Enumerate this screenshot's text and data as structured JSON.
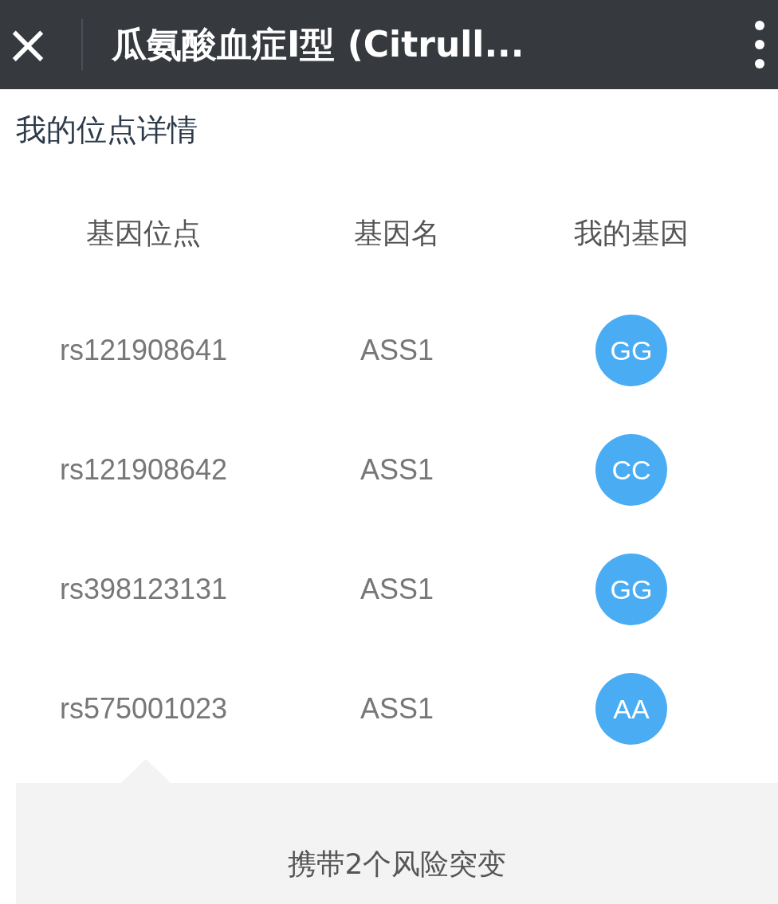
{
  "header": {
    "close_glyph": "×",
    "title": "瓜氨酸血症I型 (Citrull..."
  },
  "section_title": "我的位点详情",
  "table": {
    "columns": [
      "基因位点",
      "基因名",
      "我的基因"
    ],
    "rows": [
      {
        "locus": "rs121908641",
        "gene": "ASS1",
        "genotype": "GG"
      },
      {
        "locus": "rs121908642",
        "gene": "ASS1",
        "genotype": "CC"
      },
      {
        "locus": "rs398123131",
        "gene": "ASS1",
        "genotype": "GG"
      },
      {
        "locus": "rs575001023",
        "gene": "ASS1",
        "genotype": "AA"
      }
    ]
  },
  "summary": "携带2个风险突变"
}
